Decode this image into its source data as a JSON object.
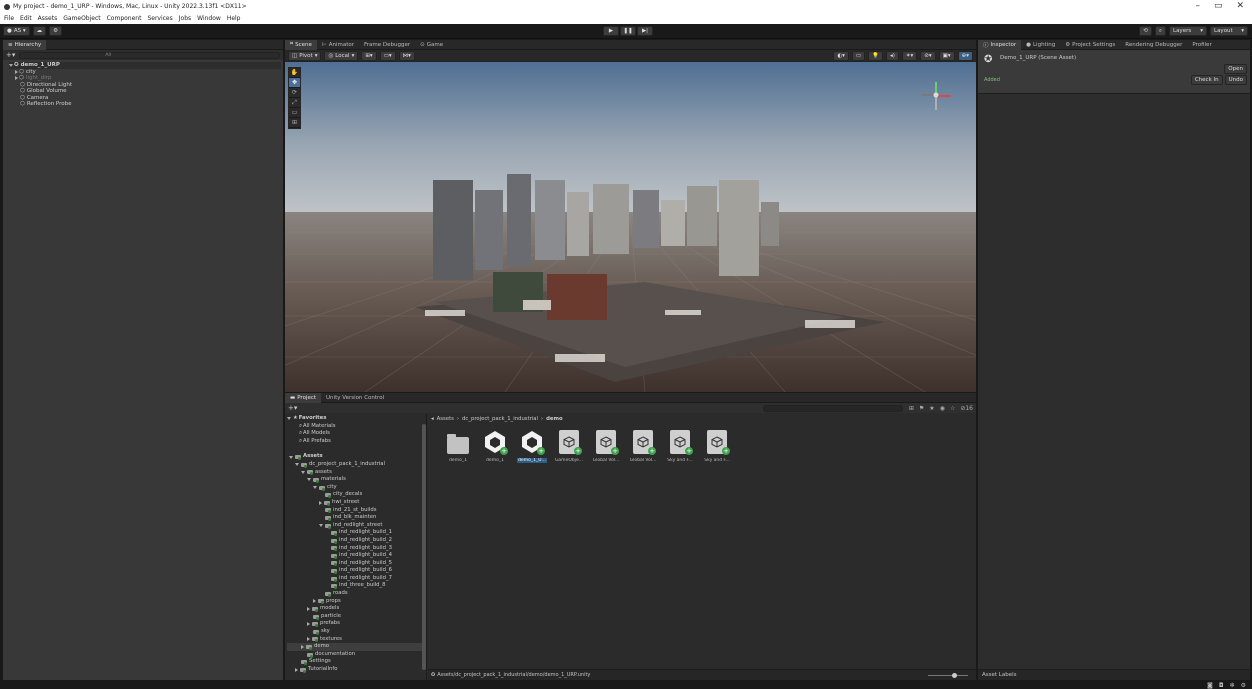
{
  "window": {
    "title": "My project - demo_1_URP - Windows, Mac, Linux - Unity 2022.3.13f1 <DX11>",
    "minimize": "–",
    "maximize": "▭",
    "close": "✕"
  },
  "menu": [
    "File",
    "Edit",
    "Assets",
    "GameObject",
    "Component",
    "Services",
    "Jobs",
    "Window",
    "Help"
  ],
  "toolbar": {
    "account": "AS ▾",
    "cloud": "☁",
    "collab": "⚙",
    "play": "▶",
    "pause": "❚❚",
    "step": "▶|",
    "history": "⟲",
    "search": "🔍",
    "layers": "Layers",
    "layout": "Layout"
  },
  "hierarchy": {
    "tab": "Hierarchy",
    "search_placeholder": "All",
    "scene": "demo_1_URP",
    "items": [
      {
        "label": "city",
        "dim": false,
        "fold": true
      },
      {
        "label": "light_dirp",
        "dim": true,
        "fold": true
      },
      {
        "label": "Directional Light",
        "dim": false,
        "fold": false
      },
      {
        "label": "Global Volume",
        "dim": false,
        "fold": false
      },
      {
        "label": "Camera",
        "dim": false,
        "fold": false
      },
      {
        "label": "Reflection Probe",
        "dim": false,
        "fold": false
      }
    ]
  },
  "scene_tabs": [
    "Scene",
    "Animator",
    "Frame Debugger",
    "Game"
  ],
  "scene_toolbar": {
    "pivot": "Pivot",
    "local": "Local",
    "persp": "< Persp"
  },
  "inspector": {
    "tabs": [
      "Inspector",
      "Lighting",
      "Project Settings",
      "Rendering Debugger",
      "Profiler"
    ],
    "asset_title": "Demo_1_URP (Scene Asset)",
    "open": "Open",
    "status": "Added",
    "check_in": "Check In",
    "undo": "Undo",
    "asset_labels": "Asset Labels"
  },
  "project": {
    "tabs": [
      "Project",
      "Unity Version Control"
    ],
    "breadcrumb": [
      "Assets",
      "dc_project_pack_1_industrial",
      "demo"
    ],
    "count": "16",
    "favorites_label": "Favorites",
    "favorites": [
      "All Materials",
      "All Models",
      "All Prefabs"
    ],
    "tree": [
      {
        "label": "Assets",
        "depth": 0,
        "fold": "open",
        "bold": true
      },
      {
        "label": "dc_project_pack_1_industrial",
        "depth": 1,
        "fold": "open"
      },
      {
        "label": "assets",
        "depth": 2,
        "fold": "open"
      },
      {
        "label": "materials",
        "depth": 3,
        "fold": "open"
      },
      {
        "label": "city",
        "depth": 4,
        "fold": "open"
      },
      {
        "label": "city_decals",
        "depth": 5,
        "fold": ""
      },
      {
        "label": "hwi_street",
        "depth": 5,
        "fold": "closed"
      },
      {
        "label": "ind_21_st_builds",
        "depth": 5,
        "fold": ""
      },
      {
        "label": "ind_blk_mainten",
        "depth": 5,
        "fold": ""
      },
      {
        "label": "ind_redlight_street",
        "depth": 5,
        "fold": "open"
      },
      {
        "label": "ind_redlight_build_1",
        "depth": 6,
        "fold": ""
      },
      {
        "label": "ind_redlight_build_2",
        "depth": 6,
        "fold": ""
      },
      {
        "label": "ind_redlight_build_3",
        "depth": 6,
        "fold": ""
      },
      {
        "label": "ind_redlight_build_4",
        "depth": 6,
        "fold": ""
      },
      {
        "label": "ind_redlight_build_5",
        "depth": 6,
        "fold": ""
      },
      {
        "label": "ind_redlight_build_6",
        "depth": 6,
        "fold": ""
      },
      {
        "label": "ind_redlight_build_7",
        "depth": 6,
        "fold": ""
      },
      {
        "label": "ind_three_build_8",
        "depth": 6,
        "fold": ""
      },
      {
        "label": "roads",
        "depth": 5,
        "fold": ""
      },
      {
        "label": "props",
        "depth": 4,
        "fold": "closed"
      },
      {
        "label": "models",
        "depth": 3,
        "fold": "closed"
      },
      {
        "label": "particle",
        "depth": 3,
        "fold": ""
      },
      {
        "label": "prefabs",
        "depth": 3,
        "fold": "closed"
      },
      {
        "label": "sky",
        "depth": 3,
        "fold": ""
      },
      {
        "label": "textures",
        "depth": 3,
        "fold": "closed"
      },
      {
        "label": "demo",
        "depth": 2,
        "fold": "closed",
        "selected": true
      },
      {
        "label": "documentation",
        "depth": 2,
        "fold": ""
      },
      {
        "label": "Settings",
        "depth": 1,
        "fold": ""
      },
      {
        "label": "TutorialInfo",
        "depth": 1,
        "fold": "closed"
      }
    ],
    "assets": [
      {
        "label": "demo_1",
        "kind": "folder"
      },
      {
        "label": "demo_1",
        "kind": "unity"
      },
      {
        "label": "demo_1_U...",
        "kind": "unity",
        "selected": true
      },
      {
        "label": "GameObje...",
        "kind": "cube"
      },
      {
        "label": "Global Vol...",
        "kind": "cube"
      },
      {
        "label": "Global Vol...",
        "kind": "cube"
      },
      {
        "label": "Sky and F...",
        "kind": "cube"
      },
      {
        "label": "Sky and F...",
        "kind": "cube"
      }
    ],
    "footer_path": "Assets/dc_project_pack_1_industrial/demo/demo_1_URP.unity"
  }
}
